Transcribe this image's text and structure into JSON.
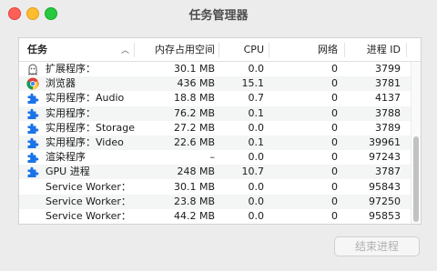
{
  "window": {
    "title": "任务管理器"
  },
  "table": {
    "columns": {
      "task": "任务",
      "memory": "内存占用空间",
      "cpu": "CPU",
      "network": "网络",
      "pid": "进程 ID"
    },
    "rows": [
      {
        "icon": "extension-ghost-icon",
        "name": "扩展程序：",
        "memory": "30.1 MB",
        "cpu": "0.0",
        "network": "0",
        "pid": "3799"
      },
      {
        "icon": "chrome-icon",
        "name": "浏览器",
        "memory": "436 MB",
        "cpu": "15.1",
        "network": "0",
        "pid": "3781"
      },
      {
        "icon": "puzzle-icon",
        "name": "实用程序：Audio",
        "memory": "18.8 MB",
        "cpu": "0.7",
        "network": "0",
        "pid": "4137"
      },
      {
        "icon": "puzzle-icon",
        "name": "实用程序：",
        "memory": "76.2 MB",
        "cpu": "0.1",
        "network": "0",
        "pid": "3788"
      },
      {
        "icon": "puzzle-icon",
        "name": "实用程序：Storage",
        "memory": "27.2 MB",
        "cpu": "0.0",
        "network": "0",
        "pid": "3789"
      },
      {
        "icon": "puzzle-icon",
        "name": "实用程序：Video",
        "memory": "22.6 MB",
        "cpu": "0.1",
        "network": "0",
        "pid": "39961"
      },
      {
        "icon": "puzzle-icon",
        "name": "渲染程序",
        "memory": "–",
        "cpu": "0.0",
        "network": "0",
        "pid": "97243"
      },
      {
        "icon": "puzzle-icon",
        "name": "GPU 进程",
        "memory": "248 MB",
        "cpu": "10.7",
        "network": "0",
        "pid": "3787"
      },
      {
        "icon": "",
        "name": "Service Worker：",
        "memory": "30.1 MB",
        "cpu": "0.0",
        "network": "0",
        "pid": "95843"
      },
      {
        "icon": "",
        "name": "Service Worker：",
        "memory": "23.8 MB",
        "cpu": "0.0",
        "network": "0",
        "pid": "97250"
      },
      {
        "icon": "",
        "name": "Service Worker：",
        "memory": "44.2 MB",
        "cpu": "0.0",
        "network": "0",
        "pid": "95853"
      }
    ]
  },
  "actions": {
    "end_process": "结束进程"
  },
  "colors": {
    "puzzle": "#1a73e8",
    "alt_row": "#f4f5f5"
  }
}
